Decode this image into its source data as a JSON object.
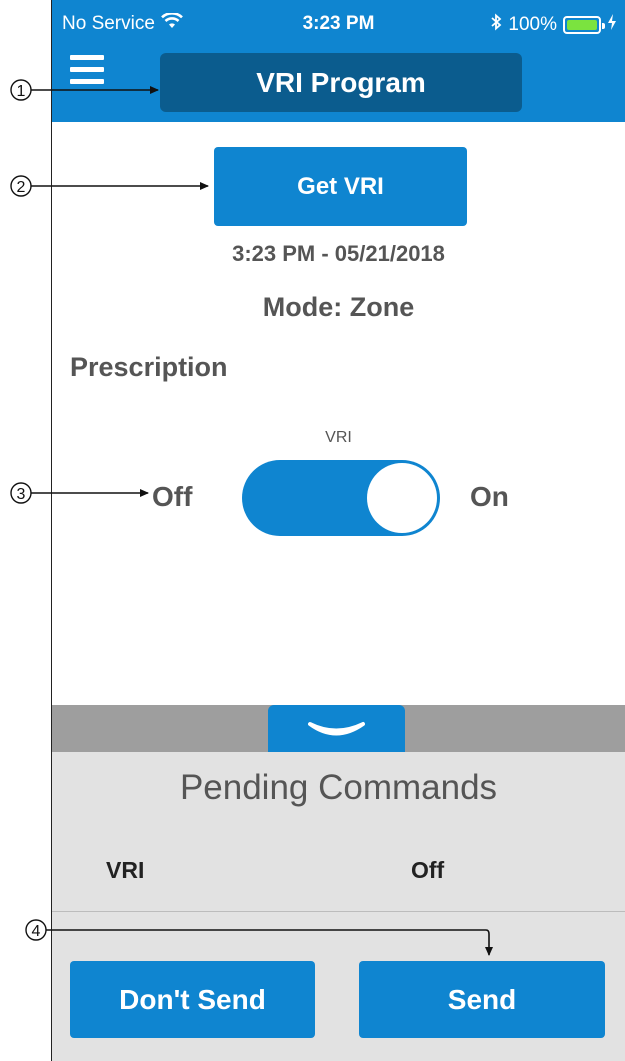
{
  "status_bar": {
    "carrier": "No Service",
    "time": "3:23 PM",
    "battery": "100%"
  },
  "header": {
    "title": "VRI Program"
  },
  "main": {
    "get_button": "Get VRI",
    "timestamp": "3:23 PM - 05/21/2018",
    "mode": "Mode: Zone",
    "section_title": "Prescription",
    "toggle": {
      "label": "VRI",
      "off_label": "Off",
      "on_label": "On",
      "state": "on"
    }
  },
  "pending": {
    "title": "Pending Commands",
    "commands": [
      {
        "name": "VRI",
        "value": "Off"
      }
    ],
    "dont_send_label": "Don't Send",
    "send_label": "Send"
  },
  "callouts": [
    "1",
    "2",
    "3",
    "4"
  ],
  "colors": {
    "primary": "#0f85d0",
    "title_box": "#0b5c8e",
    "panel": "#e2e2e2",
    "drawer_bar": "#9e9e9e"
  }
}
